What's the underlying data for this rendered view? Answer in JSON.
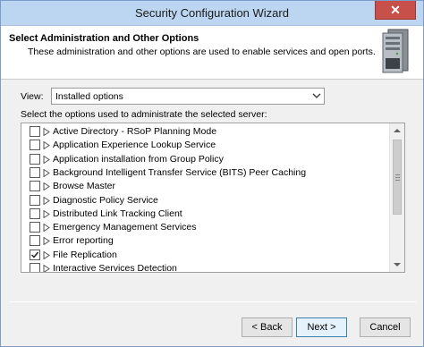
{
  "window": {
    "title": "Security Configuration Wizard",
    "close_glyph": "✕"
  },
  "header": {
    "title": "Select Administration and Other Options",
    "subtitle": "These administration and other options are used to enable services and open ports.",
    "icon": "server-computer-icon"
  },
  "view": {
    "label": "View:",
    "selected": "Installed options"
  },
  "instruction": "Select the options used to administrate the selected server:",
  "options": [
    {
      "label": "Active Directory - RSoP Planning Mode",
      "checked": false
    },
    {
      "label": "Application Experience Lookup Service",
      "checked": false
    },
    {
      "label": "Application installation from Group Policy",
      "checked": false
    },
    {
      "label": "Background Intelligent Transfer Service (BITS) Peer Caching",
      "checked": false
    },
    {
      "label": "Browse Master",
      "checked": false
    },
    {
      "label": "Diagnostic Policy Service",
      "checked": false
    },
    {
      "label": "Distributed Link Tracking Client",
      "checked": false
    },
    {
      "label": "Emergency Management Services",
      "checked": false
    },
    {
      "label": "Error reporting",
      "checked": false
    },
    {
      "label": "File Replication",
      "checked": true
    },
    {
      "label": "Interactive Services Detection",
      "checked": false
    }
  ],
  "buttons": {
    "back": "< Back",
    "next": "Next >",
    "cancel": "Cancel"
  },
  "colors": {
    "titlebar": "#bcd6f2",
    "close": "#c7504a",
    "accent": "#3c7fb1"
  }
}
